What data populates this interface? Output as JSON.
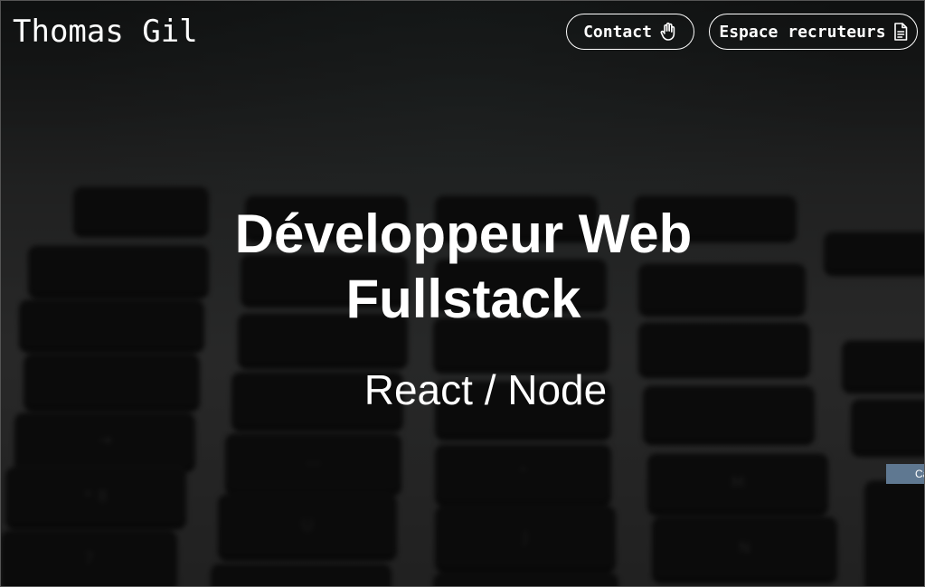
{
  "header": {
    "brand": "Thomas Gil",
    "contact_label": "Contact",
    "contact_icon": "hand-wave-icon",
    "recruiters_label": "Espace recruteurs",
    "recruiters_icon": "document-icon"
  },
  "hero": {
    "title_line1": "Développeur Web",
    "title_line2": "Fullstack",
    "subtitle": "React / Node",
    "background": "blurred-keyboard-photo"
  },
  "edge_tag": {
    "label": "Ca"
  },
  "colors": {
    "text": "#ffffff",
    "tag_bg": "#5f7891"
  }
}
